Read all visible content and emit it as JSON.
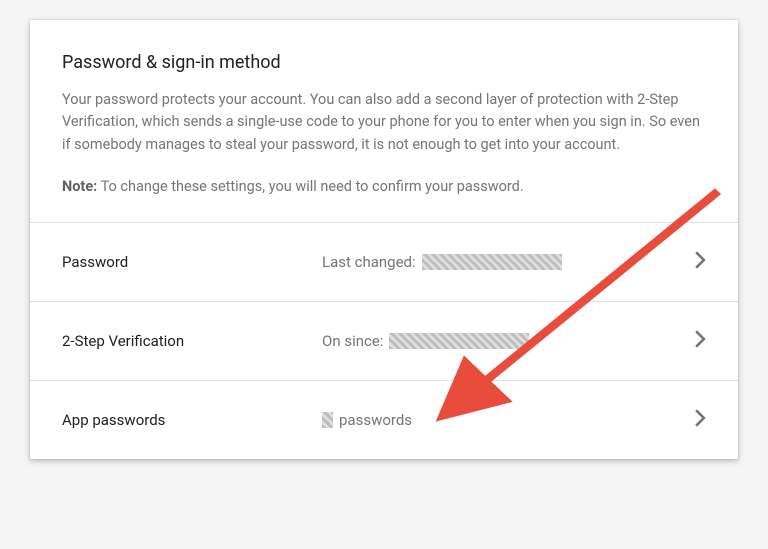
{
  "header": {
    "title": "Password & sign-in method",
    "description": "Your password protects your account. You can also add a second layer of protection with 2-Step Verification, which sends a single-use code to your phone for you to enter when you sign in. So even if somebody manages to steal your password, it is not enough to get into your account.",
    "note_label": "Note:",
    "note_text": " To change these settings, you will need to confirm your password."
  },
  "rows": {
    "password": {
      "label": "Password",
      "value_prefix": "Last changed: "
    },
    "two_step": {
      "label": "2-Step Verification",
      "value_prefix": "On since: "
    },
    "app_passwords": {
      "label": "App passwords",
      "value_suffix": " passwords"
    }
  }
}
